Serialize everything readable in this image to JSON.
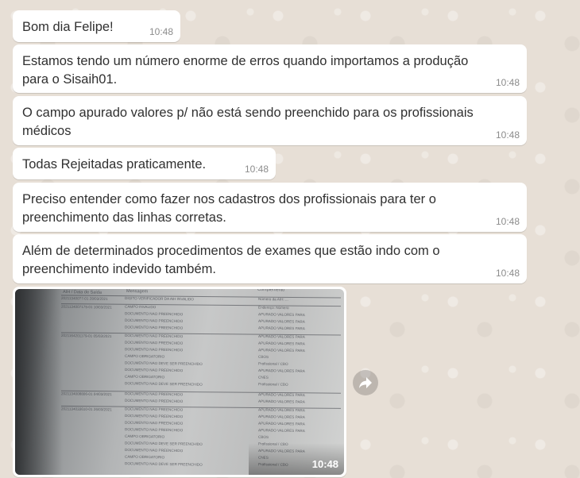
{
  "messages": [
    {
      "text": "Bom dia Felipe!",
      "time": "10:48"
    },
    {
      "text": "Estamos tendo um número enorme de erros quando importamos a produção\npara o Sisaih01.",
      "time": "10:48"
    },
    {
      "text": "O campo apurado valores p/ não está sendo preenchido para os profissionais\nmédicos",
      "time": "10:48"
    },
    {
      "text": "Todas Rejeitadas praticamente.",
      "time": "10:48"
    },
    {
      "text": "Preciso entender como fazer nos cadastros dos profissionais para ter o\npreenchimento das linhas corretas.",
      "time": "10:48"
    },
    {
      "text": "Além de determinados procedimentos de exames que estão indo com o\npreenchimento indevido também.",
      "time": "10:48"
    }
  ],
  "image_message": {
    "time": "10:48",
    "icon": "document-photo",
    "document": {
      "headers": [
        "AIH / Data de Saída",
        "Mensagem",
        "Complemento"
      ],
      "rows": [
        {
          "aih": "202113400?7-01 28/03/2021",
          "msg": "DIGITO VERIFICADOR DA AIH INVALIDO",
          "comp": "Número da AIH: ..."
        },
        {
          "aih": "2021134007175-01 10/03/2021",
          "msg": "CAMPO INVALIDO",
          "comp": "Endereço: Número"
        },
        {
          "aih": "",
          "msg": "DOCUMENTO NAO PREENCHIDO",
          "comp": "APURADO VALORES PARA"
        },
        {
          "aih": "",
          "msg": "DOCUMENTO NAO PREENCHIDO",
          "comp": "APURADO VALORES PARA"
        },
        {
          "aih": "",
          "msg": "DOCUMENTO NAO PREENCHIDO",
          "comp": "APURADO VALORES PARA"
        },
        {
          "aih": "2021164201179-01 05/03/2021",
          "msg": "DOCUMENTO NAO PREENCHIDO",
          "comp": "APURADO VALORES PARA"
        },
        {
          "aih": "",
          "msg": "DOCUMENTO NAO PREENCHIDO",
          "comp": "APURADO VALORES PARA"
        },
        {
          "aih": "",
          "msg": "DOCUMENTO NAO PREENCHIDO",
          "comp": "APURADO VALORES PARA"
        },
        {
          "aih": "",
          "msg": "CAMPO OBRIGATORIO",
          "comp": "CBOS"
        },
        {
          "aih": "",
          "msg": "DOCUMENTO NAO DEVE SER PREENCHIDO",
          "comp": "Profissional / CBO"
        },
        {
          "aih": "",
          "msg": "DOCUMENTO NAO PREENCHIDO",
          "comp": "APURADO VALORES PARA"
        },
        {
          "aih": "",
          "msg": "CAMPO OBRIGATORIO",
          "comp": "CNES"
        },
        {
          "aih": "",
          "msg": "DOCUMENTO NAO DEVE SER PREENCHIDO",
          "comp": "Profissional / CBO"
        },
        {
          "aih": "2021134008806-01 04/03/2021",
          "msg": "DOCUMENTO NAO PREENCHIDO",
          "comp": "APURADO VALORES PARA"
        },
        {
          "aih": "",
          "msg": "DOCUMENTO NAO PREENCHIDO",
          "comp": "APURADO VALORES PARA"
        },
        {
          "aih": "2021134033610-01 26/03/2021",
          "msg": "DOCUMENTO NAO PREENCHIDO",
          "comp": "APURADO VALORES PARA"
        },
        {
          "aih": "",
          "msg": "DOCUMENTO NAO PREENCHIDO",
          "comp": "APURADO VALORES PARA"
        },
        {
          "aih": "",
          "msg": "DOCUMENTO NAO PREENCHIDO",
          "comp": "APURADO VALORES PARA"
        },
        {
          "aih": "",
          "msg": "DOCUMENTO NAO PREENCHIDO",
          "comp": "APURADO VALORES PARA"
        },
        {
          "aih": "",
          "msg": "CAMPO OBRIGATORIO",
          "comp": "CBOS"
        },
        {
          "aih": "",
          "msg": "DOCUMENTO NAO DEVE SER PREENCHIDO",
          "comp": "Profissional / CBO"
        },
        {
          "aih": "",
          "msg": "DOCUMENTO NAO PREENCHIDO",
          "comp": "APURADO VALORES PARA"
        },
        {
          "aih": "",
          "msg": "CAMPO OBRIGATORIO",
          "comp": "CNES"
        },
        {
          "aih": "",
          "msg": "DOCUMENTO NAO DEVE SER PREENCHIDO",
          "comp": "Profissional / CBO"
        }
      ]
    }
  },
  "forward_icon": "forward-arrow-icon"
}
